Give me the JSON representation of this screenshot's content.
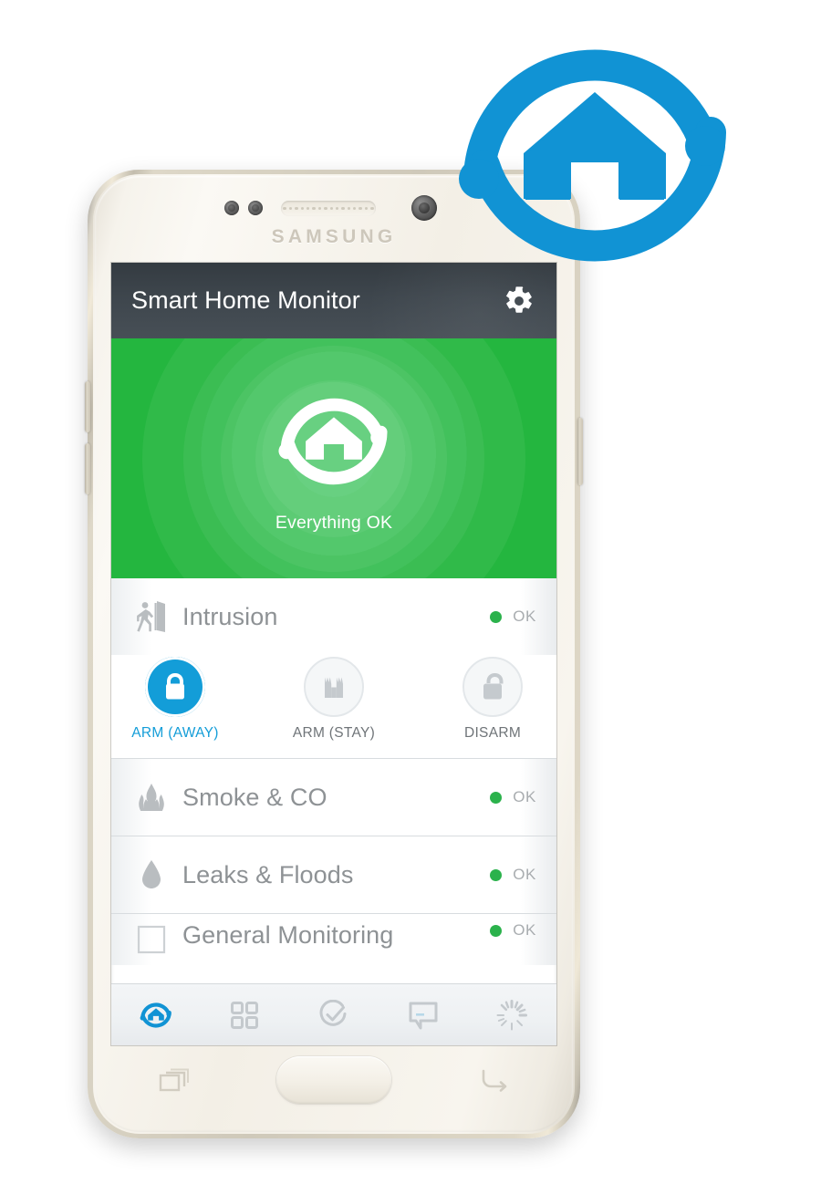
{
  "brand": {
    "logo_name": "smartthings-logo",
    "accent_color": "#1193D4"
  },
  "device": {
    "manufacturer": "SAMSUNG"
  },
  "app": {
    "title": "Smart Home Monitor",
    "settings_icon": "gear-icon",
    "hero": {
      "status_label": "Everything OK",
      "status_color": "#2BB24C",
      "badge_icon": "smartthings-home-icon"
    },
    "rows": [
      {
        "id": "intrusion",
        "title": "Intrusion",
        "icon": "person-exit-door-icon",
        "status": "OK",
        "status_color": "#2BB24C"
      },
      {
        "id": "smoke-co",
        "title": "Smoke & CO",
        "icon": "flame-icon",
        "status": "OK",
        "status_color": "#2BB24C"
      },
      {
        "id": "leaks-floods",
        "title": "Leaks & Floods",
        "icon": "water-drop-icon",
        "status": "OK",
        "status_color": "#2BB24C"
      },
      {
        "id": "general-monitoring",
        "title": "General Monitoring",
        "icon": "square-outline-icon",
        "status": "OK",
        "status_color": "#2BB24C"
      }
    ],
    "arm_controls": [
      {
        "id": "arm-away",
        "label": "ARM (AWAY)",
        "icon": "closed-padlock-icon",
        "active": true
      },
      {
        "id": "arm-stay",
        "label": "ARM (STAY)",
        "icon": "fortress-icon",
        "active": false
      },
      {
        "id": "disarm",
        "label": "DISARM",
        "icon": "open-padlock-icon",
        "active": false
      }
    ],
    "tabs": [
      {
        "id": "tab-home",
        "icon": "smartthings-home-icon",
        "active": true
      },
      {
        "id": "tab-things",
        "icon": "grid-squares-icon",
        "active": false
      },
      {
        "id": "tab-routines",
        "icon": "check-circle-icon",
        "active": false
      },
      {
        "id": "tab-messages",
        "icon": "speech-bubble-icon",
        "active": false
      },
      {
        "id": "tab-smartapps",
        "icon": "sparkle-burst-icon",
        "active": false
      }
    ]
  },
  "nav": {
    "recents_icon": "recents-icon",
    "home_button": "home-button",
    "back_icon": "back-arrow-icon"
  }
}
